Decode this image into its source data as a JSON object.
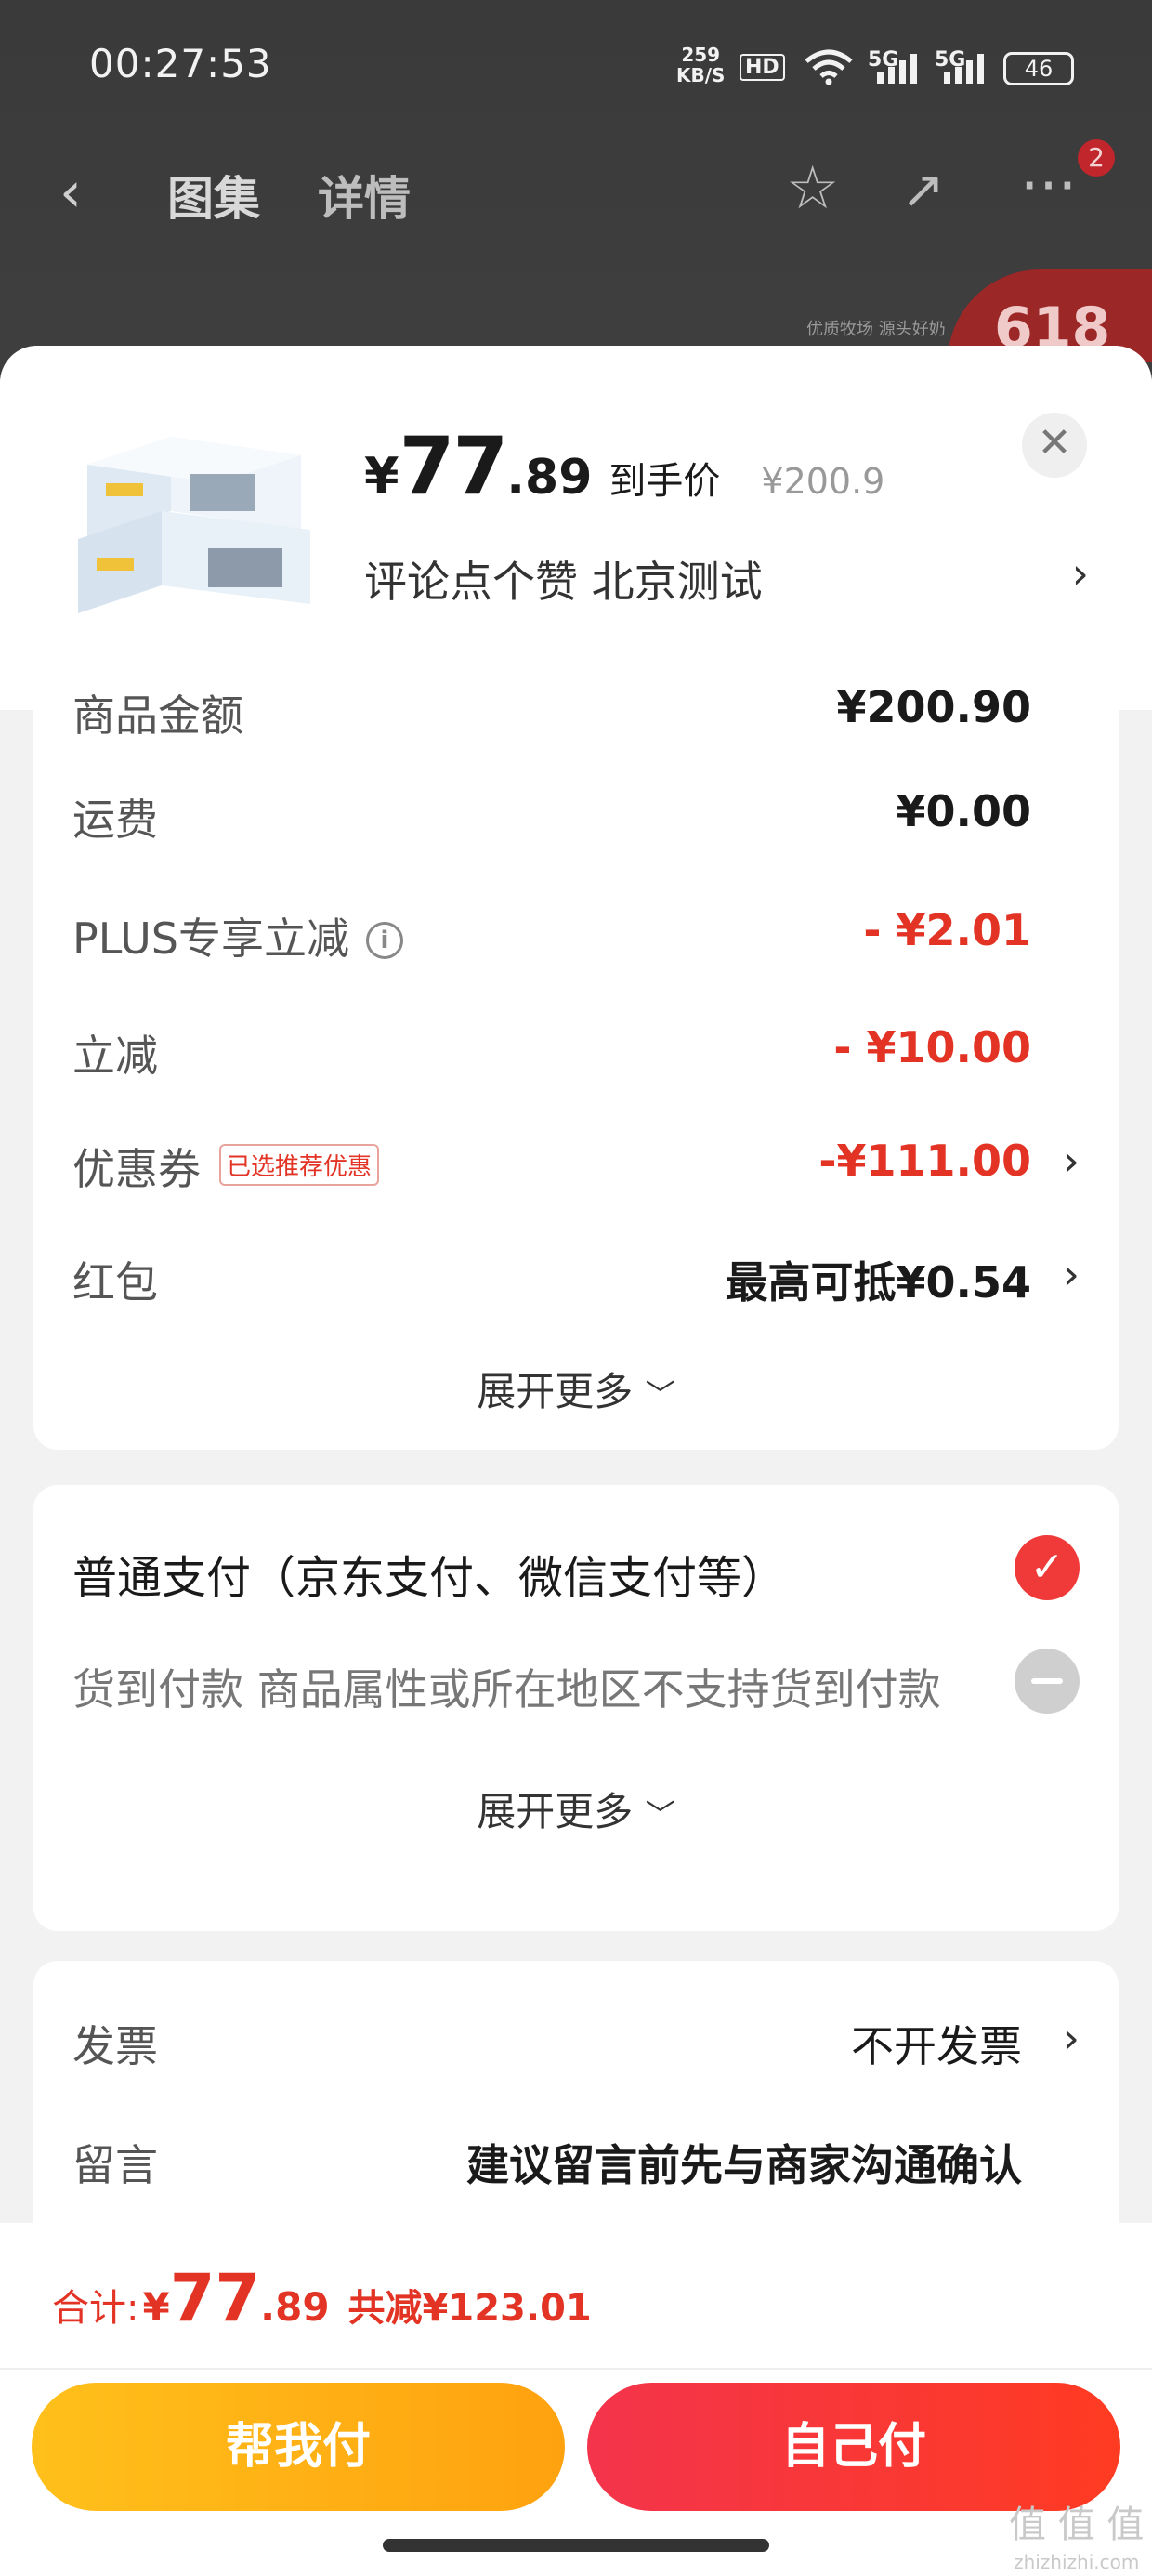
{
  "status_bar": {
    "time": "00:27:53",
    "net_speed_value": "259",
    "net_speed_unit": "KB/S",
    "hd": "HD",
    "signal_1": "5G",
    "signal_2": "5G",
    "battery": "46"
  },
  "nav": {
    "tab_gallery": "图集",
    "tab_detail": "详情",
    "more_badge": "2"
  },
  "promo": {
    "badge": "618",
    "caption": "优质牧场 源头好奶"
  },
  "product": {
    "price_symbol": "¥",
    "price_int": "77",
    "price_dec": ".89",
    "price_label": "到手价",
    "original_price": "¥200.9",
    "spec_text": "评论点个赞  北京测试"
  },
  "price_details": {
    "cut_row_label": "商品金额",
    "cut_row_value": "¥200.90",
    "shipping": {
      "label": "运费",
      "value": "¥0.00"
    },
    "plus": {
      "label": "PLUS专享立减",
      "value": "- ¥2.01"
    },
    "discount": {
      "label": "立减",
      "value": "- ¥10.00"
    },
    "coupon": {
      "label": "优惠券",
      "tag": "已选推荐优惠",
      "value": "-¥111.00"
    },
    "red_packet": {
      "label": "红包",
      "value": "最高可抵¥0.54"
    },
    "expand_label": "展开更多"
  },
  "payment": {
    "normal": "普通支付（京东支付、微信支付等）",
    "cod": "货到付款 商品属性或所在地区不支持货到付款",
    "expand_label": "展开更多"
  },
  "extra": {
    "invoice": {
      "label": "发票",
      "value": "不开发票"
    },
    "message": {
      "label": "留言",
      "placeholder": "建议留言前先与商家沟通确认"
    }
  },
  "footer": {
    "total_label": "合计:",
    "total_symbol": "¥",
    "total_int": "77",
    "total_dec": ".89",
    "saved": "共减¥123.01",
    "help_pay": "帮我付",
    "self_pay": "自己付",
    "watermark": "值 值 值",
    "watermark_url": "zhizhizhi.com"
  },
  "colors": {
    "accent_red": "#e23324",
    "check_red": "#f03a3a",
    "help_yellow": "#ffb31a",
    "self_red": "#f7353a"
  },
  "icons": [
    "back-icon",
    "star-icon",
    "share-icon",
    "more-icon",
    "close-icon",
    "chevron-right-icon",
    "info-icon",
    "check-icon",
    "disabled-icon",
    "chevron-down-icon"
  ]
}
